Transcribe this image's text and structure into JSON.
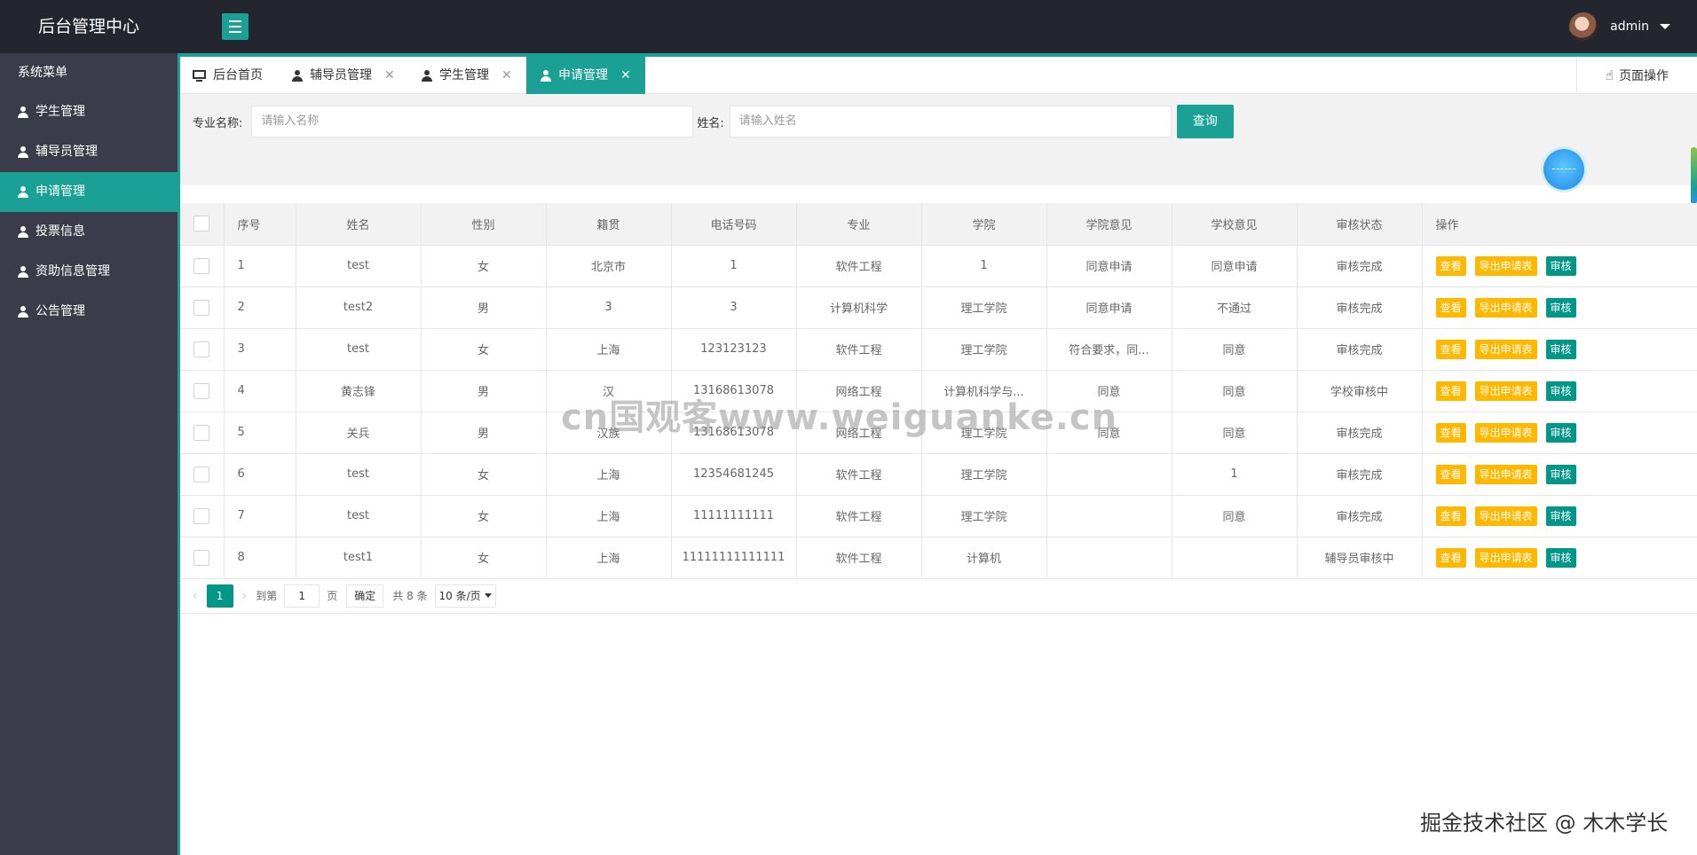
{
  "header": {
    "logo": "后台管理中心",
    "username": "admin"
  },
  "sidebar": {
    "title": "系统菜单",
    "items": [
      {
        "label": "学生管理",
        "active": false
      },
      {
        "label": "辅导员管理",
        "active": false
      },
      {
        "label": "申请管理",
        "active": true
      },
      {
        "label": "投票信息",
        "active": false
      },
      {
        "label": "资助信息管理",
        "active": false
      },
      {
        "label": "公告管理",
        "active": false
      }
    ]
  },
  "tabs": [
    {
      "label": "后台首页",
      "active": false
    },
    {
      "label": "辅导员管理",
      "active": false
    },
    {
      "label": "学生管理",
      "active": false
    },
    {
      "label": "申请管理",
      "active": true
    }
  ],
  "page_ops": "页面操作",
  "search": {
    "major_label": "专业名称:",
    "major_placeholder": "请输入名称",
    "name_label": "姓名:",
    "name_placeholder": "请输入姓名",
    "query_button": "查询"
  },
  "table": {
    "headers": [
      "序号",
      "姓名",
      "性别",
      "籍贯",
      "电话号码",
      "专业",
      "学院",
      "学院意见",
      "学校意见",
      "审核状态",
      "操作"
    ],
    "rows": [
      [
        "1",
        "test",
        "女",
        "北京市",
        "1",
        "软件工程",
        "1",
        "同意申请",
        "同意申请",
        "审核完成"
      ],
      [
        "2",
        "test2",
        "男",
        "3",
        "3",
        "计算机科学",
        "理工学院",
        "同意申请",
        "不通过",
        "审核完成"
      ],
      [
        "3",
        "test",
        "女",
        "上海",
        "123123123",
        "软件工程",
        "理工学院",
        "符合要求，同...",
        "同意",
        "审核完成"
      ],
      [
        "4",
        "黄志锋",
        "男",
        "汉",
        "13168613078",
        "网络工程",
        "计算机科学与...",
        "同意",
        "同意",
        "学校审核中"
      ],
      [
        "5",
        "关兵",
        "男",
        "汉族",
        "13168613078",
        "网络工程",
        "理工学院",
        "同意",
        "同意",
        "审核完成"
      ],
      [
        "6",
        "test",
        "女",
        "上海",
        "12354681245",
        "软件工程",
        "理工学院",
        "",
        "1",
        "审核完成"
      ],
      [
        "7",
        "test",
        "女",
        "上海",
        "11111111111",
        "软件工程",
        "理工学院",
        "",
        "同意",
        "审核完成"
      ],
      [
        "8",
        "test1",
        "女",
        "上海",
        "11111111111111",
        "软件工程",
        "计算机",
        "",
        "",
        "辅导员审核中"
      ]
    ],
    "actions": {
      "view": "查看",
      "export": "导出申请表",
      "review": "审核"
    }
  },
  "pager": {
    "current_page": "1",
    "goto_label": "到第",
    "goto_value": "1",
    "page_unit": "页",
    "confirm": "确定",
    "total": "共 8 条",
    "page_size": "10 条/页"
  },
  "watermarks": {
    "center": "cn国观客www.weiguanke.cn",
    "corner": "掘金技术社区 @ 木木学长"
  },
  "colors": {
    "accent": "#1aa094",
    "header_bg": "#23262e",
    "sidebar_bg": "#3a3d49",
    "btn_yellow": "#ffb800",
    "btn_green": "#009688"
  }
}
